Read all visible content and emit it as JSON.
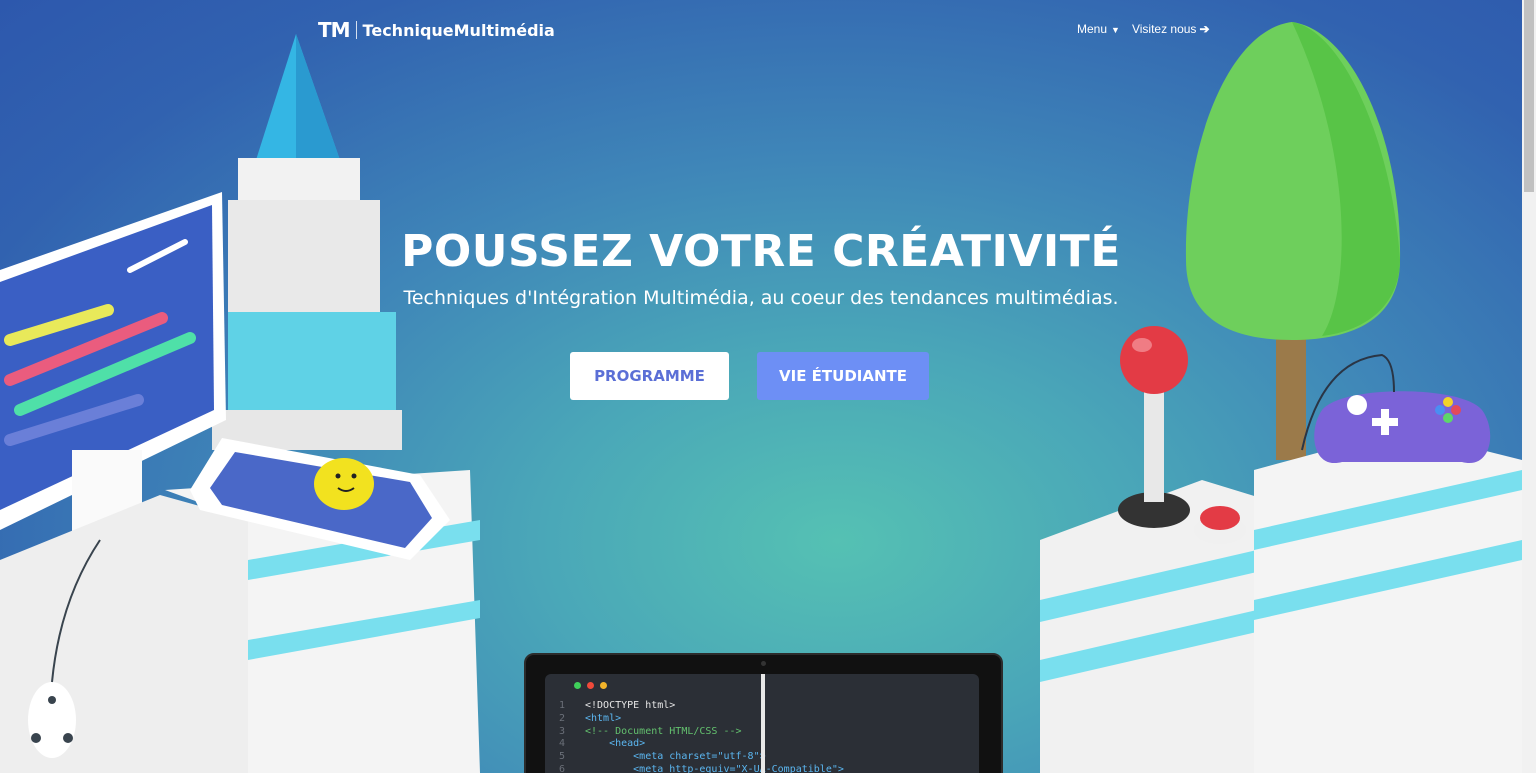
{
  "brand": {
    "mark": "TM",
    "name": "TechniqueMultimédia"
  },
  "nav": {
    "menu_label": "Menu",
    "visit_label": "Visitez nous"
  },
  "hero": {
    "title": "POUSSEZ VOTRE CRÉATIVITÉ",
    "subtitle": "Techniques d'Intégration Multimédia, au coeur des tendances multimédias.",
    "btn_programme": "PROGRAMME",
    "btn_vie": "VIE ÉTUDIANTE"
  },
  "editor": {
    "lines": [
      {
        "n": "1",
        "text": "<!DOCTYPE html>"
      },
      {
        "n": "2",
        "text": "<html>"
      },
      {
        "n": "3",
        "text": "<!-- Document HTML/CSS -->"
      },
      {
        "n": "4",
        "text": "    <head>"
      },
      {
        "n": "5",
        "text": "        <meta charset=\"utf-8\">"
      },
      {
        "n": "6",
        "text": "        <meta http-equiv=\"X-UA-Compatible\">"
      }
    ]
  },
  "icons": {
    "menu_caret": "chevron-down-icon",
    "visit_arrow": "arrow-right-icon"
  },
  "colors": {
    "bg_top": "#2d58ad",
    "bg_bottom": "#55c1b3",
    "btn_primary": "#6d8ff5",
    "btn_text": "#5b6fd6"
  }
}
